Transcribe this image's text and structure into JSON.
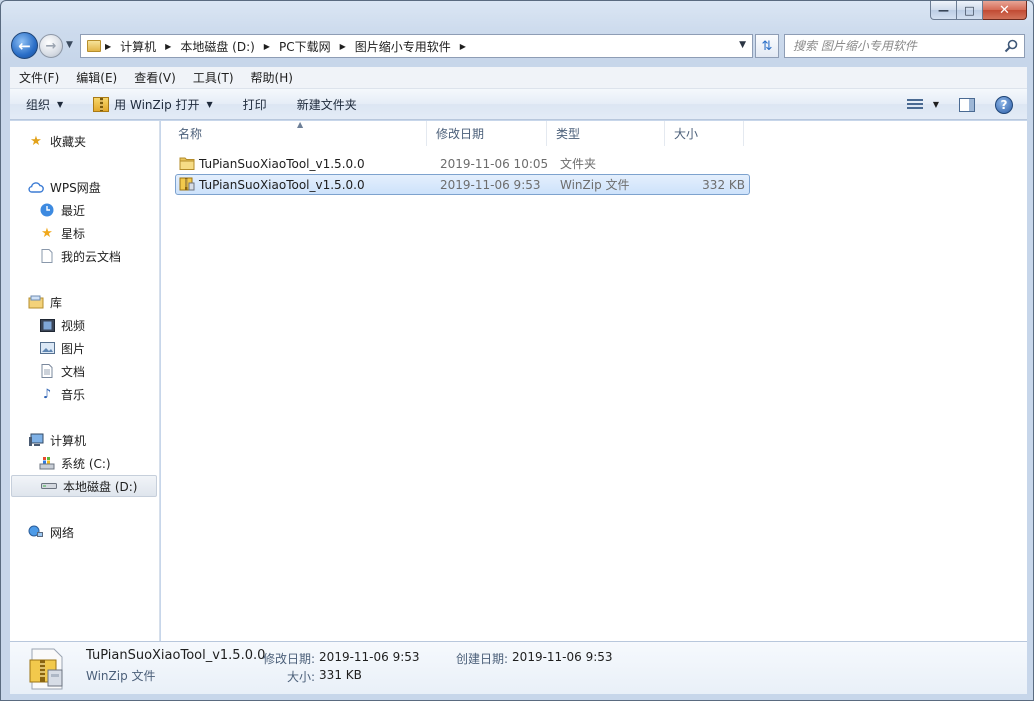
{
  "window": {
    "caption_buttons": {
      "minimize": "—",
      "maximize": "□",
      "close": "✕"
    }
  },
  "address": {
    "crumbs": [
      "计算机",
      "本地磁盘 (D:)",
      "PC下载网",
      "图片缩小专用软件"
    ]
  },
  "search": {
    "placeholder": "搜索 图片缩小专用软件"
  },
  "menu": [
    "文件(F)",
    "编辑(E)",
    "查看(V)",
    "工具(T)",
    "帮助(H)"
  ],
  "commands": {
    "organize": "组织",
    "open_with": "用 WinZip 打开",
    "print": "打印",
    "new_folder": "新建文件夹"
  },
  "nav": {
    "favorites": "收藏夹",
    "wps": "WPS网盘",
    "recent": "最近",
    "starred": "星标",
    "cloud_docs": "我的云文档",
    "libraries": "库",
    "videos": "视频",
    "pictures": "图片",
    "documents": "文档",
    "music": "音乐",
    "computer": "计算机",
    "drive_c": "系统 (C:)",
    "drive_d": "本地磁盘 (D:)",
    "network": "网络"
  },
  "columns": {
    "name": "名称",
    "modified": "修改日期",
    "type": "类型",
    "size": "大小"
  },
  "files": [
    {
      "name": "TuPianSuoXiaoTool_v1.5.0.0",
      "modified": "2019-11-06 10:05",
      "type": "文件夹",
      "size": "",
      "icon": "folder-icon"
    },
    {
      "name": "TuPianSuoXiaoTool_v1.5.0.0",
      "modified": "2019-11-06 9:53",
      "type": "WinZip 文件",
      "size": "332 KB",
      "icon": "winzip-file-icon"
    }
  ],
  "details": {
    "name": "TuPianSuoXiaoTool_v1.5.0.0",
    "type": "WinZip 文件",
    "modified_label": "修改日期:",
    "modified_value": "2019-11-06 9:53",
    "created_label": "创建日期:",
    "created_value": "2019-11-06 9:53",
    "size_label": "大小:",
    "size_value": "331 KB"
  },
  "colors": {
    "selection": "#cde2fb",
    "selection_border": "#7da2ce",
    "accent": "#2a6ec7"
  }
}
